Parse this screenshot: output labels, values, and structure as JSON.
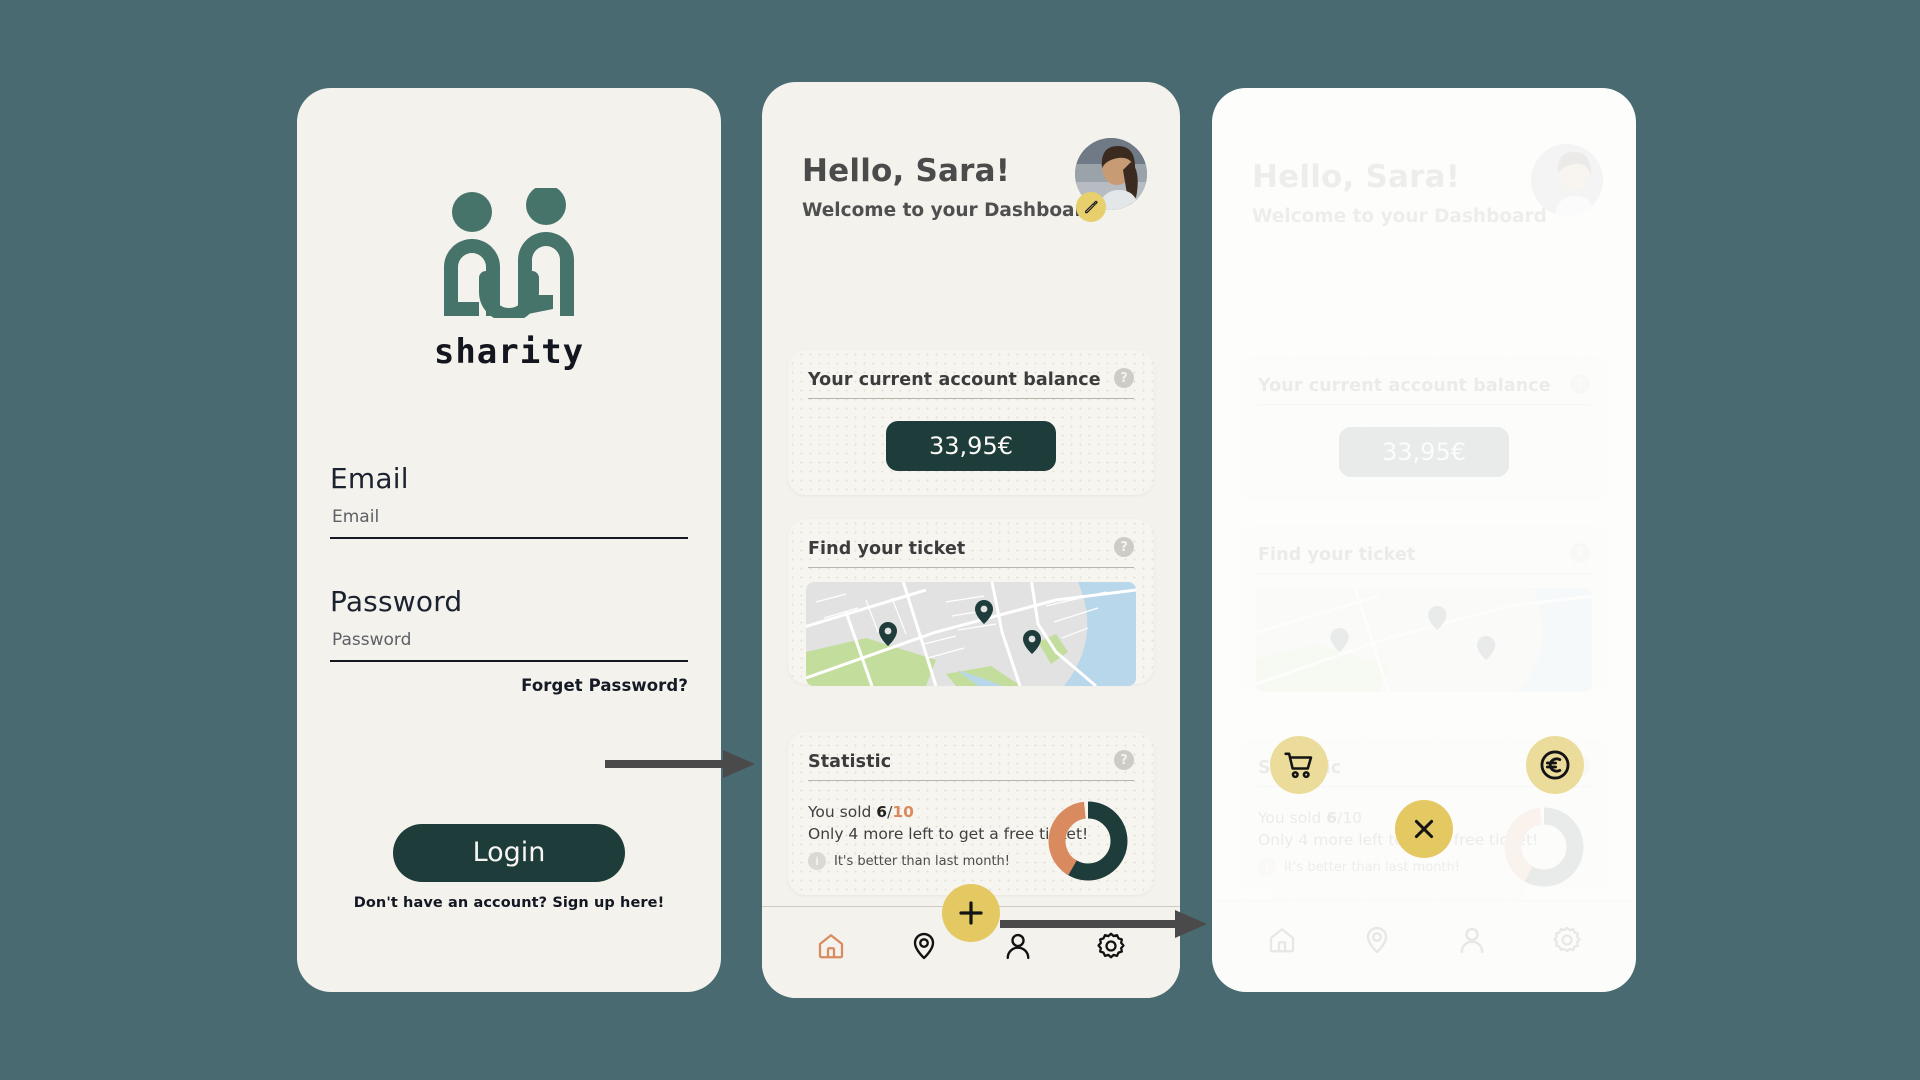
{
  "theme": {
    "page_bg": "#4a6a72",
    "card_bg": "#f4f2ec",
    "brand_green": "#46746a",
    "dark_teal": "#1e3c3a",
    "accent_yellow": "#e4c963",
    "accent_orange": "#d98b5f"
  },
  "screens": {
    "login": {
      "name": "login-screen",
      "brand_name": "sharity",
      "logo_icon": "two-people-handshake-icon",
      "email": {
        "label": "Email",
        "placeholder": "Email",
        "value": ""
      },
      "password": {
        "label": "Password",
        "placeholder": "Password",
        "value": ""
      },
      "forget_password": "Forget Password?",
      "login_button": "Login",
      "signup_prompt": "Don't have an account? ",
      "signup_link": "Sign up here!"
    },
    "dashboard": {
      "name": "dashboard-screen",
      "greeting": "Hello, Sara!",
      "subtitle": "Welcome to your Dashboard",
      "avatar_icon": "user-photo-avatar",
      "avatar_edit_icon": "pencil-edit-icon",
      "balance_card": {
        "title": "Your current account balance",
        "help_icon": "question-mark-icon",
        "help_label": "?",
        "amount": "33,95€"
      },
      "map_card": {
        "title": "Find your ticket",
        "help_icon": "question-mark-icon",
        "help_label": "?",
        "map_icon": "map-preview",
        "pins": 3
      },
      "statistic_card": {
        "title": "Statistic",
        "help_icon": "question-mark-icon",
        "help_label": "?",
        "sold_prefix": "You sold ",
        "sold_count": "6",
        "sold_separator": "/",
        "sold_total": "10",
        "sold_hint": "Only 4 more left to get a free ticket!",
        "note_icon": "info-icon",
        "note_icon_label": "i",
        "note": "It's better than last month!"
      },
      "nav": {
        "items": [
          {
            "name": "nav-home",
            "icon": "home-icon",
            "active": true
          },
          {
            "name": "nav-location",
            "icon": "location-pin-icon",
            "active": false
          },
          {
            "name": "nav-profile",
            "icon": "person-icon",
            "active": false
          },
          {
            "name": "nav-settings",
            "icon": "gear-icon",
            "active": false
          }
        ],
        "fab_icon": "plus-icon"
      }
    },
    "modal": {
      "name": "action-sheet-screen",
      "actions": [
        {
          "name": "buy-ticket-action",
          "icon": "shopping-cart-icon"
        },
        {
          "name": "sell-ticket-action",
          "icon": "euro-coin-icon"
        }
      ],
      "close_icon": "close-x-icon"
    }
  },
  "chart_data": {
    "type": "pie",
    "title": "Statistic",
    "categories": [
      "Sold",
      "Remaining"
    ],
    "values": [
      6,
      4
    ],
    "total": 10,
    "colors": [
      "#1e3c3a",
      "#d98b5f"
    ],
    "legend": "none",
    "annotation": "You sold 6/10"
  },
  "flow_arrows": [
    {
      "name": "arrow-login-to-dashboard",
      "color": "#4a4a4a"
    },
    {
      "name": "arrow-dashboard-to-modal",
      "color": "#4a4a4a"
    }
  ]
}
